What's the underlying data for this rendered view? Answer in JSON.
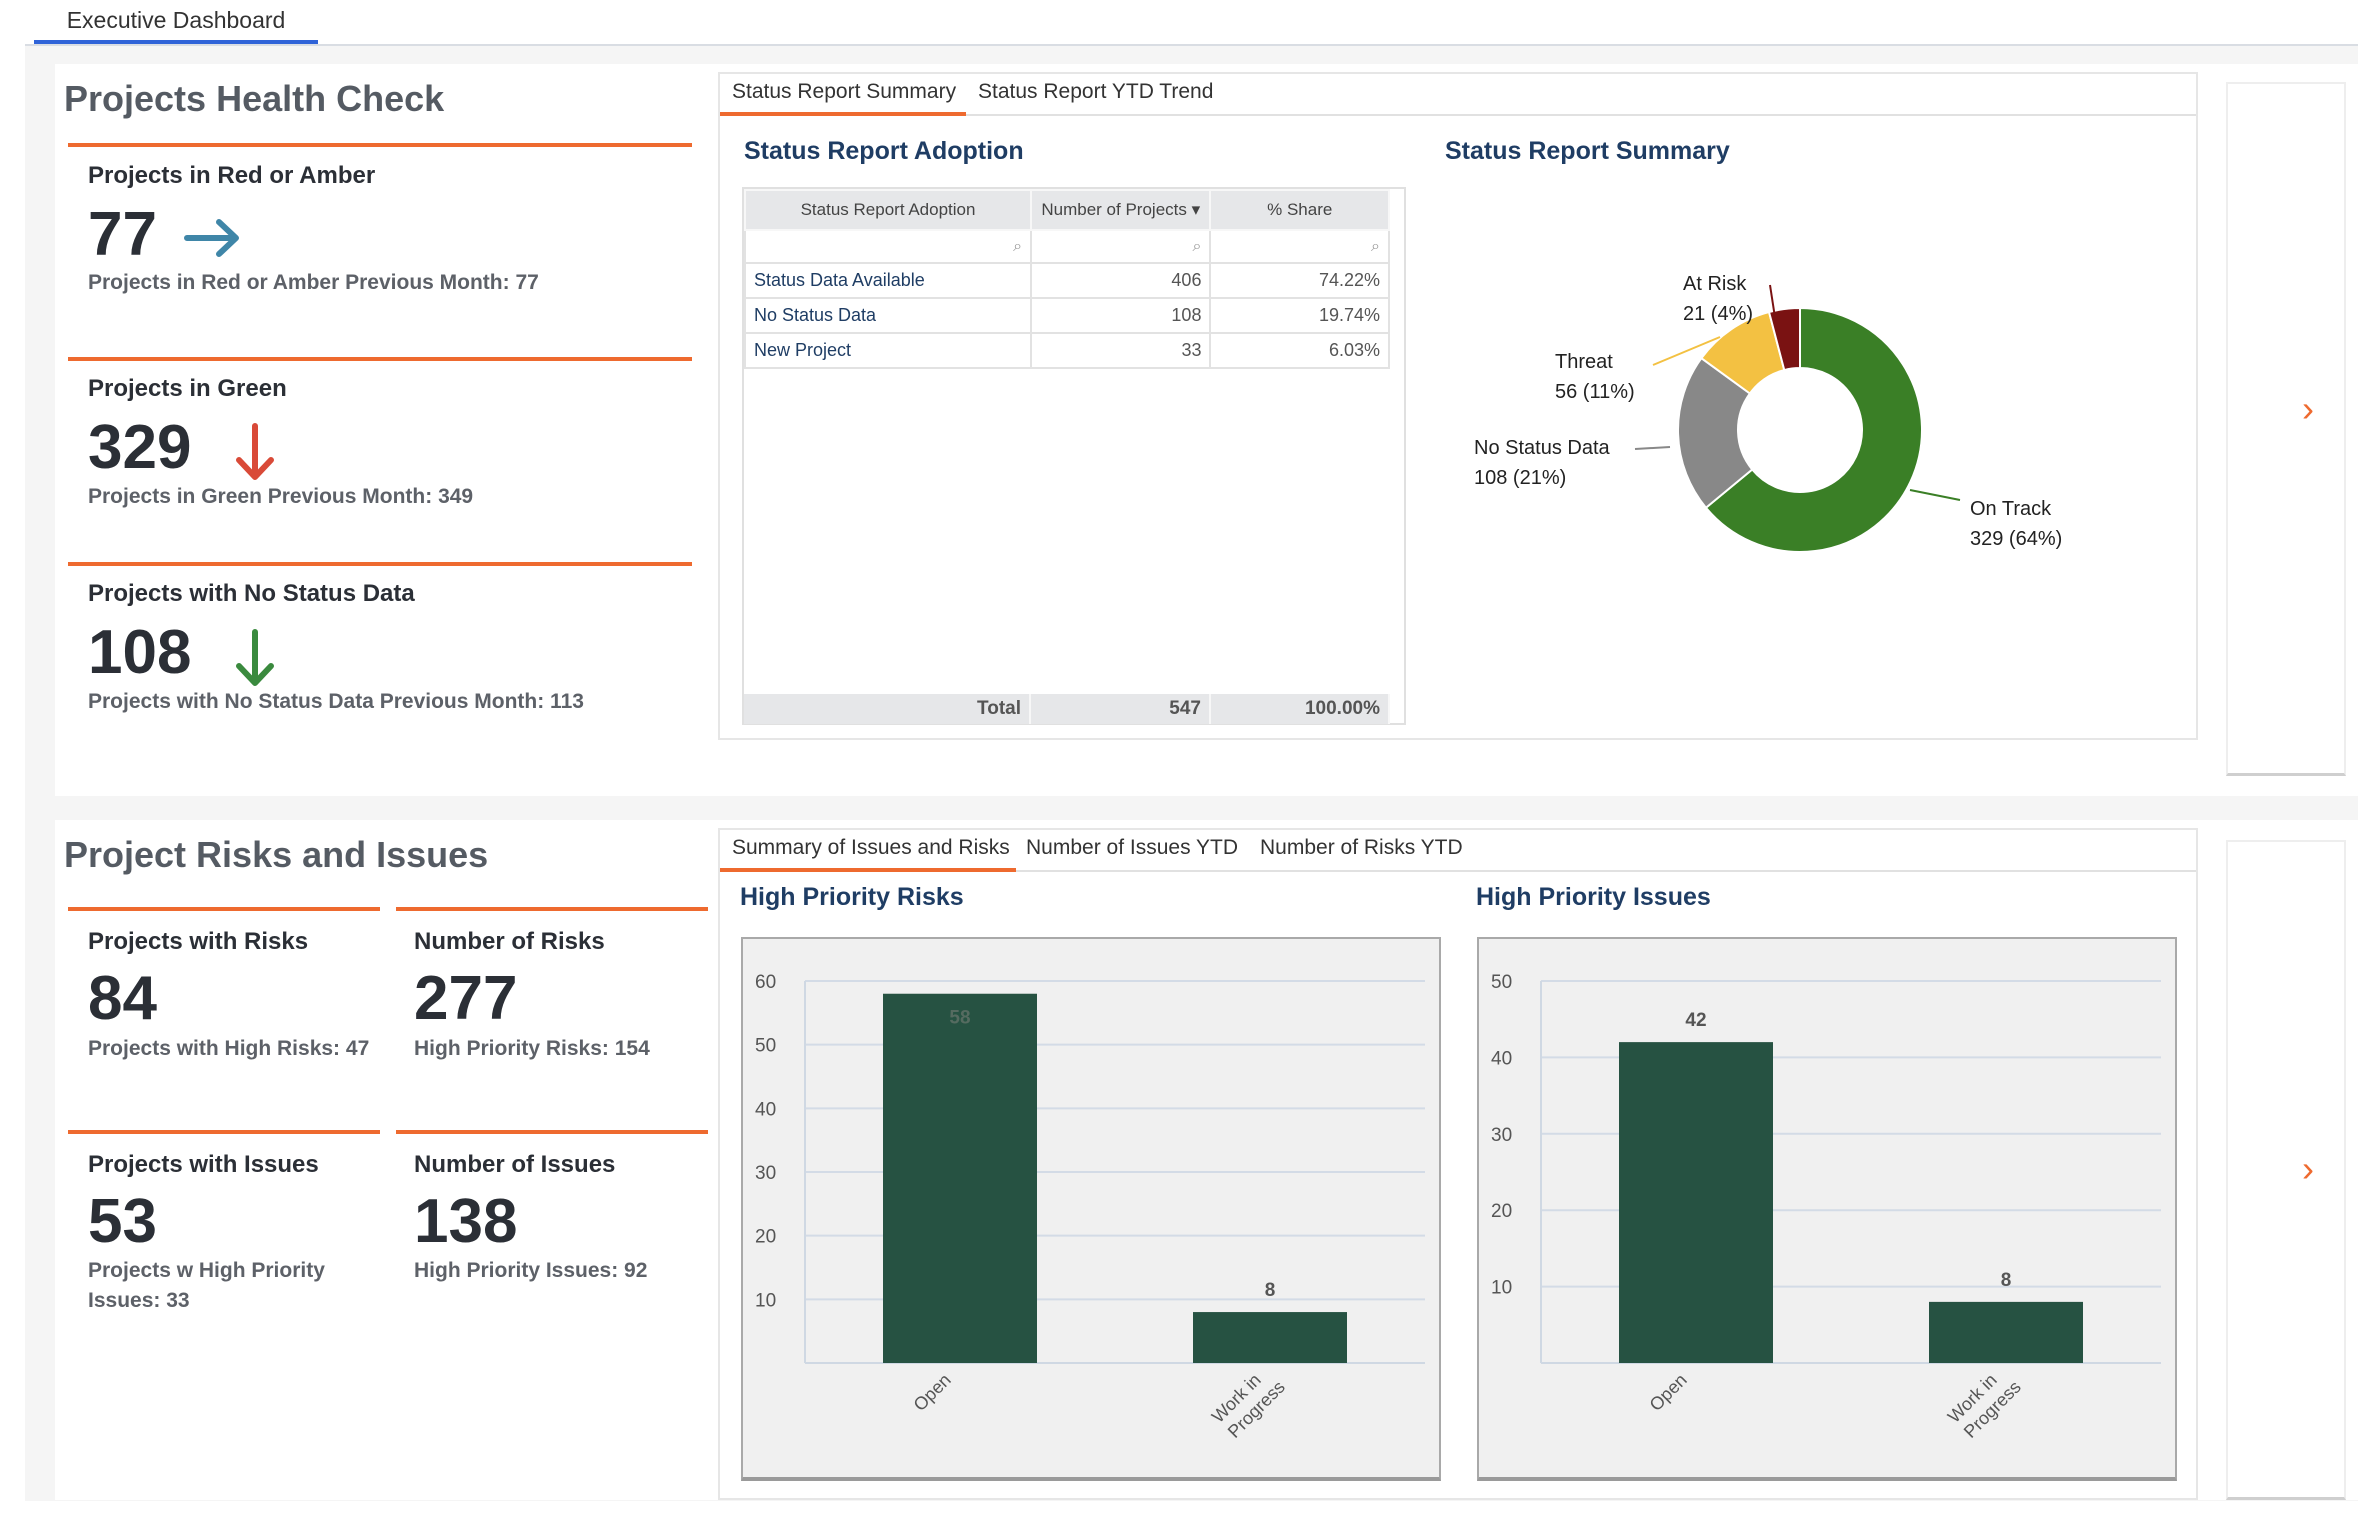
{
  "top_tabs": [
    {
      "label": "Executive Dashboard",
      "active": true
    }
  ],
  "colors": {
    "accent_orange": "#ee6a2f",
    "tab_blue": "#2f63d8",
    "title_navy": "#1f3d64",
    "bar_green": "#265242",
    "trend_flat": "#3f86a8",
    "trend_down_bad": "#d94a38",
    "trend_down_good": "#3a8a3e"
  },
  "health": {
    "title": "Projects Health Check",
    "kpis": [
      {
        "title": "Projects in Red or Amber",
        "value": "77",
        "trend_icon": "arrow-right-icon",
        "sub": "Projects in Red or Amber Previous Month: 77"
      },
      {
        "title": "Projects in Green",
        "value": "329",
        "trend_icon": "arrow-down-icon",
        "sub": "Projects in Green Previous Month: 349"
      },
      {
        "title": "Projects with No Status Data",
        "value": "108",
        "trend_icon": "arrow-down-icon",
        "sub": "Projects with No Status Data Previous Month: 113"
      }
    ]
  },
  "status_panel": {
    "tabs": [
      {
        "label": "Status Report Summary",
        "active": true
      },
      {
        "label": "Status Report YTD Trend",
        "active": false
      }
    ],
    "adoption": {
      "title": "Status Report Adoption",
      "columns": [
        "Status Report Adoption",
        "Number of Projects ▾",
        "% Share"
      ],
      "rows": [
        {
          "name": "Status Data Available",
          "count": "406",
          "share": "74.22%"
        },
        {
          "name": "No Status Data",
          "count": "108",
          "share": "19.74%"
        },
        {
          "name": "New Project",
          "count": "33",
          "share": "6.03%"
        }
      ],
      "total": {
        "label": "Total",
        "count": "547",
        "share": "100.00%"
      },
      "filter_icon": "search-icon"
    },
    "summary_title": "Status Report Summary"
  },
  "risks": {
    "title": "Project Risks and Issues",
    "kpis": [
      {
        "title": "Projects with Risks",
        "value": "84",
        "sub": "Projects with High Risks: 47"
      },
      {
        "title": "Number of Risks",
        "value": "277",
        "sub": "High Priority Risks: 154"
      },
      {
        "title": "Projects with Issues",
        "value": "53",
        "sub": "Projects w High Priority Issues: 33"
      },
      {
        "title": "Number of Issues",
        "value": "138",
        "sub": "High Priority Issues: 92"
      }
    ]
  },
  "issues_panel": {
    "tabs": [
      {
        "label": "Summary of Issues and Risks",
        "active": true
      },
      {
        "label": "Number of Issues YTD",
        "active": false
      },
      {
        "label": "Number of Risks YTD",
        "active": false
      }
    ]
  },
  "side_panels": [
    {
      "icon": "chevron-right-icon",
      "glyph": "›"
    },
    {
      "icon": "chevron-right-icon",
      "glyph": "›"
    }
  ],
  "chart_data": [
    {
      "type": "pie",
      "title": "Status Report Summary",
      "donut": true,
      "slices": [
        {
          "label": "On Track",
          "value": 329,
          "pct": "64%",
          "color": "#3a7f26"
        },
        {
          "label": "No Status Data",
          "value": 108,
          "pct": "21%",
          "color": "#888888"
        },
        {
          "label": "Threat",
          "value": 56,
          "pct": "11%",
          "color": "#f3c142"
        },
        {
          "label": "At Risk",
          "value": 21,
          "pct": "4%",
          "color": "#7a1212"
        }
      ]
    },
    {
      "type": "bar",
      "title": "High Priority Risks",
      "categories": [
        "Open",
        "Work in Progress"
      ],
      "values": [
        58,
        8
      ],
      "xlabel": "",
      "ylabel": "",
      "ylim": [
        0,
        60
      ],
      "yticks": [
        10,
        20,
        30,
        40,
        50,
        60
      ],
      "grid": true,
      "bar_color": "#265242"
    },
    {
      "type": "bar",
      "title": "High Priority Issues",
      "categories": [
        "Open",
        "Work in Progress"
      ],
      "values": [
        42,
        8
      ],
      "xlabel": "",
      "ylabel": "",
      "ylim": [
        0,
        50
      ],
      "yticks": [
        10,
        20,
        30,
        40,
        50
      ],
      "grid": true,
      "bar_color": "#265242"
    }
  ]
}
